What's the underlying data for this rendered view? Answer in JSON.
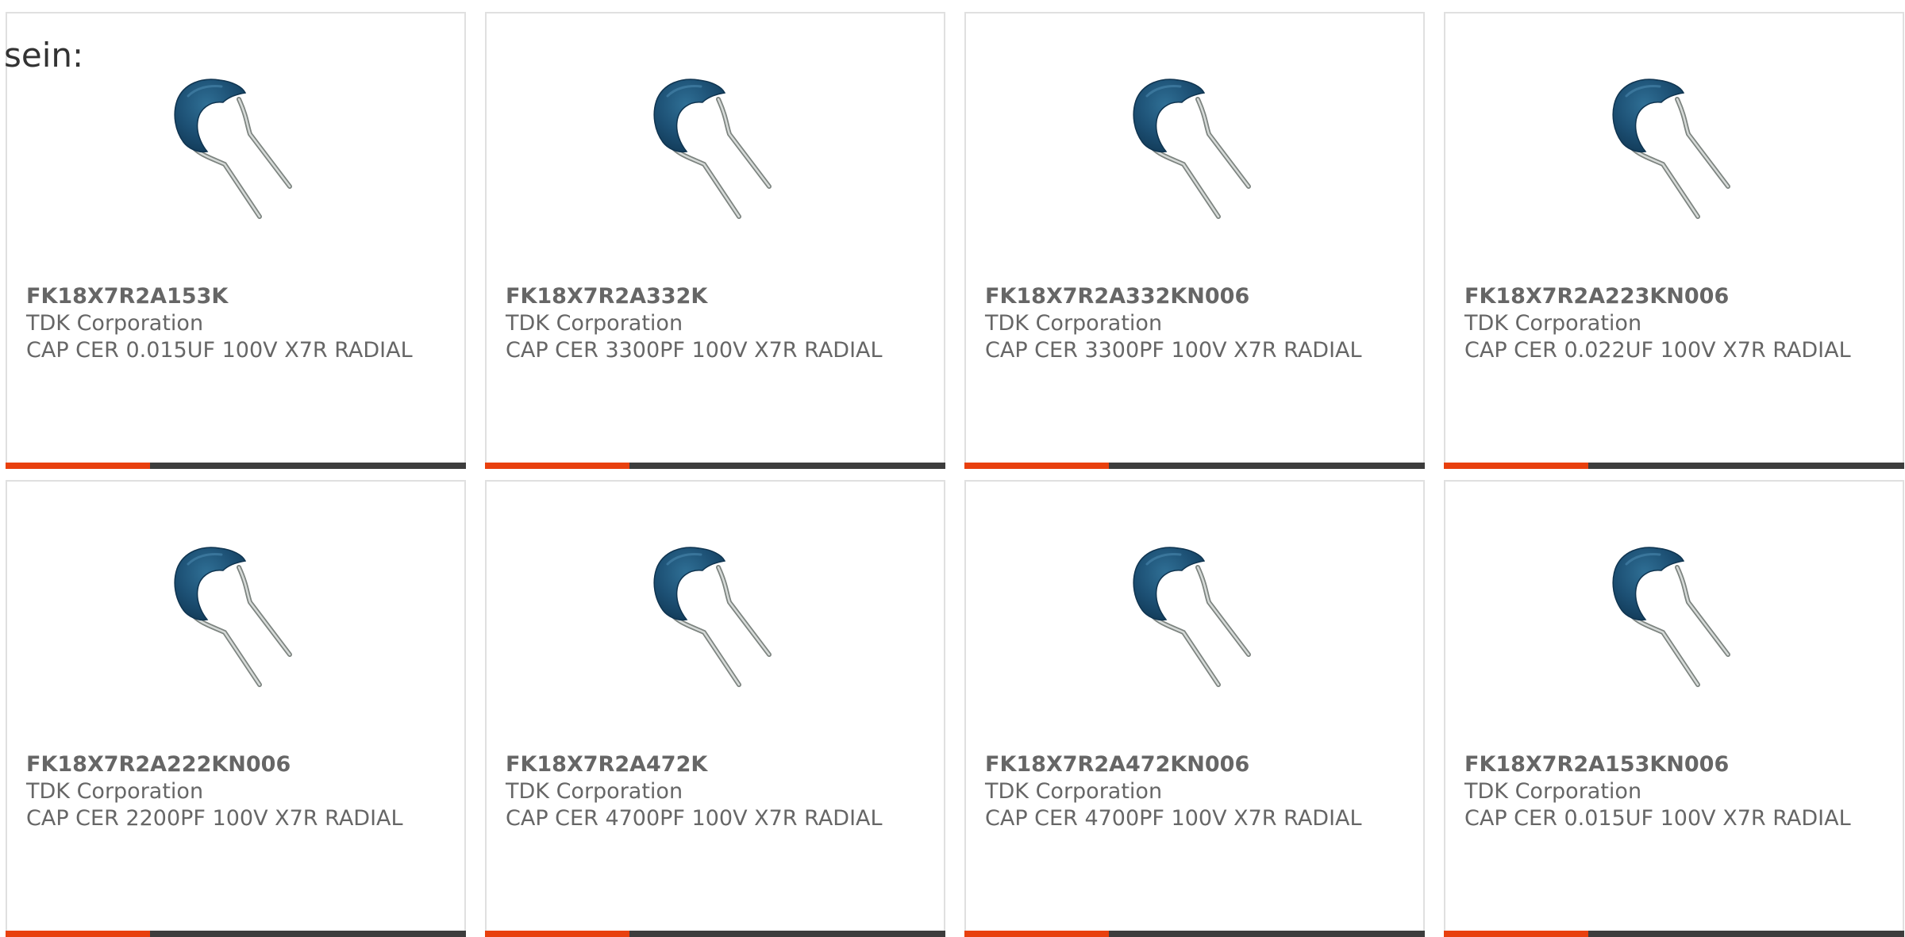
{
  "intro_text": "sein:",
  "colors": {
    "accent": "#e8400e",
    "bar": "#3d3d3d",
    "text": "#666666",
    "border": "#e0e0e0"
  },
  "products": [
    {
      "part": "FK18X7R2A153K",
      "manufacturer": "TDK Corporation",
      "description": "CAP CER 0.015UF 100V X7R RADIAL",
      "icon": "ceramic-capacitor-icon"
    },
    {
      "part": "FK18X7R2A332K",
      "manufacturer": "TDK Corporation",
      "description": "CAP CER 3300PF 100V X7R RADIAL",
      "icon": "ceramic-capacitor-icon"
    },
    {
      "part": "FK18X7R2A332KN006",
      "manufacturer": "TDK Corporation",
      "description": "CAP CER 3300PF 100V X7R RADIAL",
      "icon": "ceramic-capacitor-icon"
    },
    {
      "part": "FK18X7R2A223KN006",
      "manufacturer": "TDK Corporation",
      "description": "CAP CER 0.022UF 100V X7R RADIAL",
      "icon": "ceramic-capacitor-icon"
    },
    {
      "part": "FK18X7R2A222KN006",
      "manufacturer": "TDK Corporation",
      "description": "CAP CER 2200PF 100V X7R RADIAL",
      "icon": "ceramic-capacitor-icon"
    },
    {
      "part": "FK18X7R2A472K",
      "manufacturer": "TDK Corporation",
      "description": "CAP CER 4700PF 100V X7R RADIAL",
      "icon": "ceramic-capacitor-icon"
    },
    {
      "part": "FK18X7R2A472KN006",
      "manufacturer": "TDK Corporation",
      "description": "CAP CER 4700PF 100V X7R RADIAL",
      "icon": "ceramic-capacitor-icon"
    },
    {
      "part": "FK18X7R2A153KN006",
      "manufacturer": "TDK Corporation",
      "description": "CAP CER 0.015UF 100V X7R RADIAL",
      "icon": "ceramic-capacitor-icon"
    }
  ]
}
